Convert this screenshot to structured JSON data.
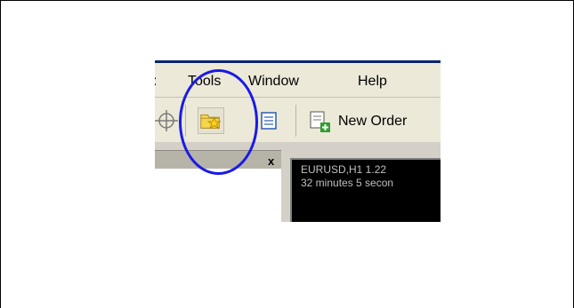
{
  "menu": {
    "items": [
      {
        "label": ":",
        "name": "menu-item-file-fragment"
      },
      {
        "label": "Tools",
        "name": "menu-tools"
      },
      {
        "label": "Window",
        "name": "menu-window"
      },
      {
        "label": "Help",
        "name": "menu-help"
      }
    ]
  },
  "toolbar": {
    "new_order_label": "New Order",
    "icons": [
      "crosshair-icon",
      "favorites-folder-icon",
      "list-view-icon",
      "new-order-icon"
    ]
  },
  "panel": {
    "close_label": "x"
  },
  "chart": {
    "header_line": "EURUSD,H1  1.22",
    "timer_line": "32 minutes 5 secon"
  },
  "colors": {
    "highlight": "#1a1ae6",
    "chart_background": "#000000",
    "title_bar": "#0a246a"
  }
}
